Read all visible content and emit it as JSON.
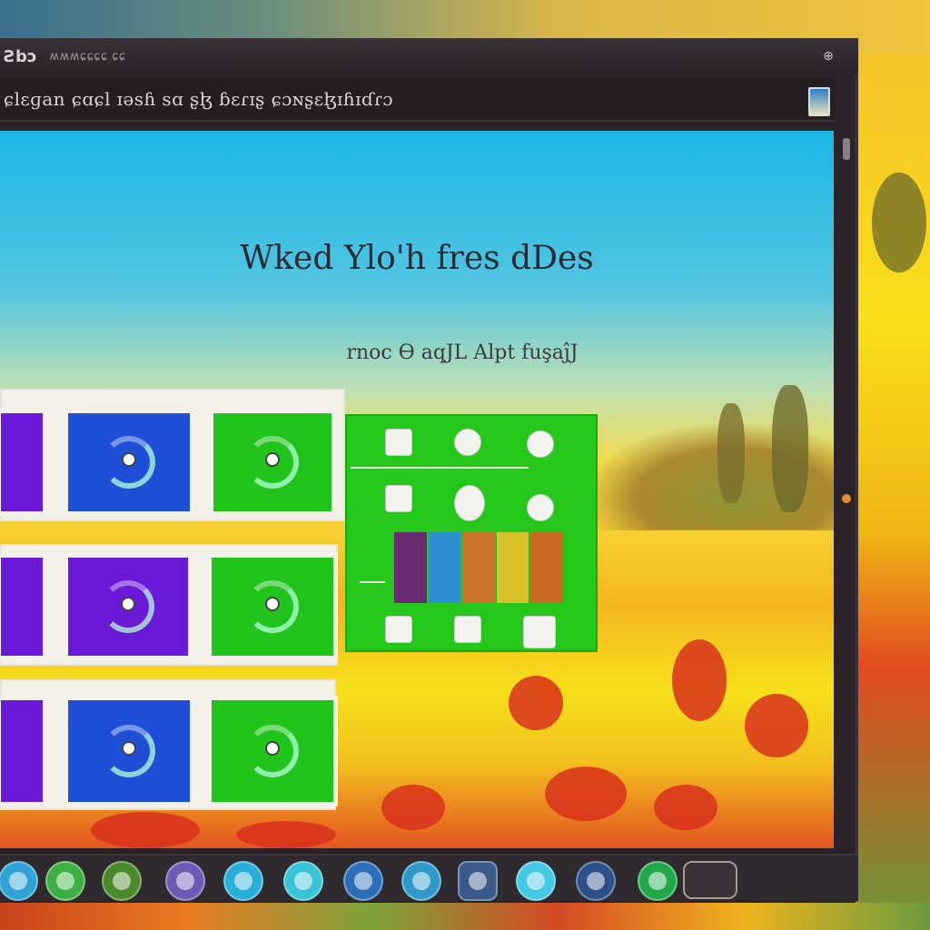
{
  "window": {
    "app_title": "Ƨbɔ",
    "app_subtitle": "ʍʍʍɕɕɕɕ ɕɕ",
    "window_icon": "⊕"
  },
  "addressbar": {
    "address_text": "ɕlɛɡan ɕɑɕl ɪəsɦ sɑ ʂɮ ɓɛɾɪʂ ɕɔɴʂɛɮɪɦɪɗɾɔ"
  },
  "hero": {
    "title": "Wked Ylo'h fres dDes",
    "subtitle": "rnoc Ɵ aqJL Alpt fuşaĵJ"
  },
  "colors": {
    "tile_blue": "#1f4fd6",
    "tile_purple": "#6b19d9",
    "tile_green": "#21c41a",
    "sky": "#1bb6e6",
    "field": "#f6e01a"
  },
  "tile_rows": [
    {
      "tiles": [
        "purple-tile",
        "blue-tile",
        "green-tile"
      ]
    },
    {
      "tiles": [
        "purple-tile",
        "purple-tile",
        "green-tile"
      ]
    },
    {
      "tiles": [
        "blue-tile",
        "blue-tile",
        "green-tile"
      ]
    }
  ],
  "dock": {
    "icons": [
      "chrome-icon",
      "green-app-icon",
      "green-app-icon",
      "purple-app-icon",
      "blue-app-icon",
      "cyan-app-icon",
      "blue-app-icon",
      "globe-icon",
      "finder-icon",
      "cyan-app-icon",
      "photos-icon",
      "green-app-icon",
      "tray-icon"
    ]
  }
}
